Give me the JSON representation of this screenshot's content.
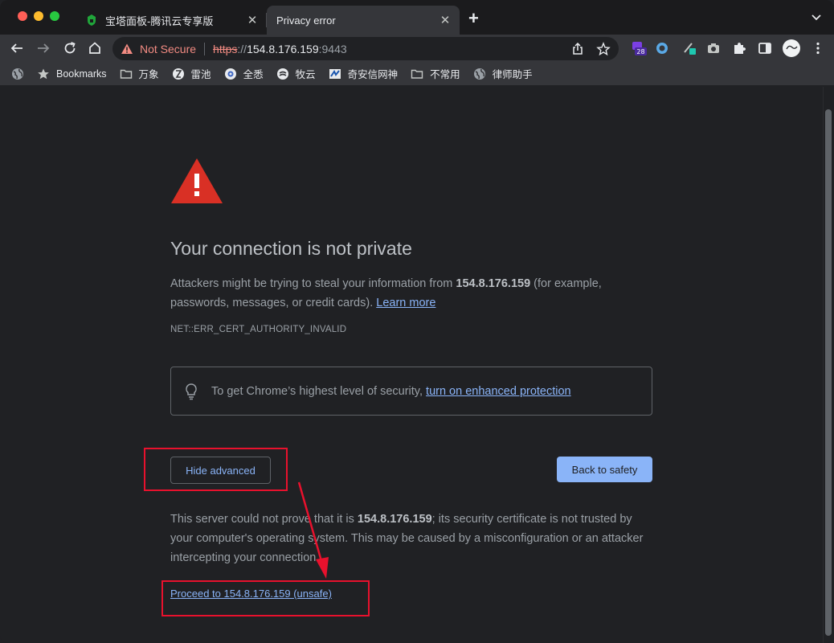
{
  "tabs": [
    {
      "title": "宝塔面板-腾讯云专享版",
      "icon": "bt-panel-favicon",
      "active": false
    },
    {
      "title": "Privacy error",
      "icon": "none",
      "active": true
    }
  ],
  "toolbar": {
    "not_secure_label": "Not Secure",
    "url_scheme": "https",
    "url_sep": "://",
    "url_host": "154.8.176.159",
    "url_port": ":9443",
    "extension_badge": "28"
  },
  "bookmarks": [
    {
      "label": "Bookmarks",
      "icon": "star-icon"
    },
    {
      "label": "万象",
      "icon": "folder-icon"
    },
    {
      "label": "雷池",
      "icon": "leichi-icon"
    },
    {
      "label": "全悉",
      "icon": "quanxi-icon"
    },
    {
      "label": "牧云",
      "icon": "muyun-icon"
    },
    {
      "label": "奇安信网神",
      "icon": "qianxin-icon"
    },
    {
      "label": "不常用",
      "icon": "folder-icon"
    },
    {
      "label": "律师助手",
      "icon": "globe-icon"
    }
  ],
  "page": {
    "heading": "Your connection is not private",
    "p1_before": "Attackers might be trying to steal your information from ",
    "p1_host": "154.8.176.159",
    "p1_after": " (for example, passwords, messages, or credit cards). ",
    "learn_more": "Learn more",
    "error_code": "NET::ERR_CERT_AUTHORITY_INVALID",
    "enhanced_text": "To get Chrome’s highest level of security, ",
    "enhanced_link": "turn on enhanced protection",
    "hide_advanced": "Hide advanced",
    "back_to_safety": "Back to safety",
    "p2_before": "This server could not prove that it is ",
    "p2_host": "154.8.176.159",
    "p2_after": "; its security certificate is not trusted by your computer's operating system. This may be caused by a misconfiguration or an attacker intercepting your connection.",
    "proceed": "Proceed to 154.8.176.159 (unsafe)"
  },
  "colors": {
    "annotation_red": "#e8112d",
    "link_blue": "#8ab4f8",
    "warning_red": "#d93025"
  }
}
